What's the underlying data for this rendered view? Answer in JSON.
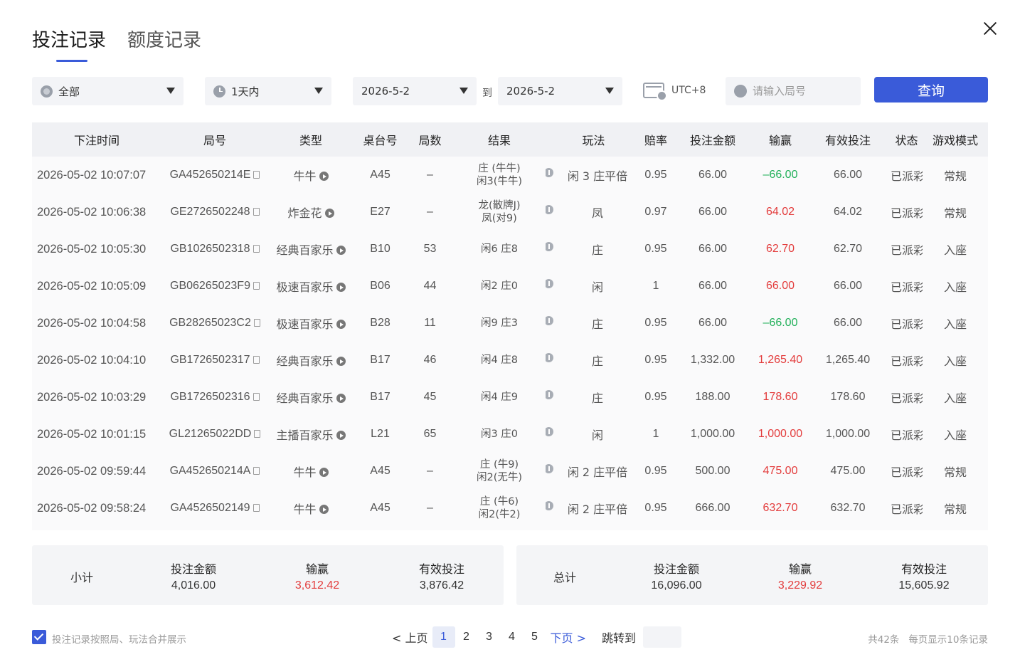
{
  "tabs": [
    {
      "label": "投注记录",
      "active": true
    },
    {
      "label": "额度记录",
      "active": false
    }
  ],
  "filters": {
    "game_select": "全部",
    "period_select": "1天内",
    "date_from": "2026-5-2",
    "to_label": "到",
    "date_to": "2026-5-2",
    "timezone": "UTC+8",
    "round_search_placeholder": "请输入局号",
    "query_button": "查询"
  },
  "table": {
    "headers": [
      "下注时间",
      "局号",
      "类型",
      "桌台号",
      "局数",
      "结果",
      "玩法",
      "赔率",
      "投注金额",
      "输赢",
      "有效投注",
      "状态",
      "游戏模式"
    ],
    "rows": [
      {
        "time": "2026-05-02 10:07:07",
        "round": "GA452650214E",
        "type": "牛牛",
        "table": "A45",
        "count": "–",
        "result1": "庄 (牛牛)",
        "result2": "闲3(牛牛)",
        "play": "闲 3 庄平倍",
        "odds": "0.95",
        "bet": "66.00",
        "win": "–66.00",
        "sign": "neg",
        "valid": "66.00",
        "status": "已派彩",
        "mode": "常规"
      },
      {
        "time": "2026-05-02 10:06:38",
        "round": "GE2726502248",
        "type": "炸金花",
        "table": "E27",
        "count": "–",
        "result1": "龙(散牌J)",
        "result2": "凤(对9)",
        "play": "凤",
        "odds": "0.97",
        "bet": "66.00",
        "win": "64.02",
        "sign": "pos",
        "valid": "64.02",
        "status": "已派彩",
        "mode": "常规"
      },
      {
        "time": "2026-05-02 10:05:30",
        "round": "GB1026502318",
        "type": "经典百家乐",
        "table": "B10",
        "count": "53",
        "result1": "闲6 庄8",
        "result2": "",
        "play": "庄",
        "odds": "0.95",
        "bet": "66.00",
        "win": "62.70",
        "sign": "pos",
        "valid": "62.70",
        "status": "已派彩",
        "mode": "入座"
      },
      {
        "time": "2026-05-02 10:05:09",
        "round": "GB06265023F9",
        "type": "极速百家乐",
        "table": "B06",
        "count": "44",
        "result1": "闲2 庄0",
        "result2": "",
        "play": "闲",
        "odds": "1",
        "bet": "66.00",
        "win": "66.00",
        "sign": "pos",
        "valid": "66.00",
        "status": "已派彩",
        "mode": "入座"
      },
      {
        "time": "2026-05-02 10:04:58",
        "round": "GB28265023C2",
        "type": "极速百家乐",
        "table": "B28",
        "count": "11",
        "result1": "闲9 庄3",
        "result2": "",
        "play": "庄",
        "odds": "0.95",
        "bet": "66.00",
        "win": "–66.00",
        "sign": "neg",
        "valid": "66.00",
        "status": "已派彩",
        "mode": "入座"
      },
      {
        "time": "2026-05-02 10:04:10",
        "round": "GB1726502317",
        "type": "经典百家乐",
        "table": "B17",
        "count": "46",
        "result1": "闲4 庄8",
        "result2": "",
        "play": "庄",
        "odds": "0.95",
        "bet": "1,332.00",
        "win": "1,265.40",
        "sign": "pos",
        "valid": "1,265.40",
        "status": "已派彩",
        "mode": "入座"
      },
      {
        "time": "2026-05-02 10:03:29",
        "round": "GB1726502316",
        "type": "经典百家乐",
        "table": "B17",
        "count": "45",
        "result1": "闲4 庄9",
        "result2": "",
        "play": "庄",
        "odds": "0.95",
        "bet": "188.00",
        "win": "178.60",
        "sign": "pos",
        "valid": "178.60",
        "status": "已派彩",
        "mode": "入座"
      },
      {
        "time": "2026-05-02 10:01:15",
        "round": "GL21265022DD",
        "type": "主播百家乐",
        "table": "L21",
        "count": "65",
        "result1": "闲3 庄0",
        "result2": "",
        "play": "闲",
        "odds": "1",
        "bet": "1,000.00",
        "win": "1,000.00",
        "sign": "pos",
        "valid": "1,000.00",
        "status": "已派彩",
        "mode": "入座"
      },
      {
        "time": "2026-05-02 09:59:44",
        "round": "GA452650214A",
        "type": "牛牛",
        "table": "A45",
        "count": "–",
        "result1": "庄 (牛9)",
        "result2": "闲2(无牛)",
        "play": "闲 2 庄平倍",
        "odds": "0.95",
        "bet": "500.00",
        "win": "475.00",
        "sign": "pos",
        "valid": "475.00",
        "status": "已派彩",
        "mode": "常规"
      },
      {
        "time": "2026-05-02 09:58:24",
        "round": "GA4526502149",
        "type": "牛牛",
        "table": "A45",
        "count": "–",
        "result1": "庄 (牛6)",
        "result2": "闲2(牛2)",
        "play": "闲 2 庄平倍",
        "odds": "0.95",
        "bet": "666.00",
        "win": "632.70",
        "sign": "pos",
        "valid": "632.70",
        "status": "已派彩",
        "mode": "常规"
      }
    ]
  },
  "subtotal": {
    "label": "小计",
    "bet_label": "投注金额",
    "bet": "4,016.00",
    "win_label": "输赢",
    "win": "3,612.42",
    "valid_label": "有效投注",
    "valid": "3,876.42"
  },
  "total": {
    "label": "总计",
    "bet_label": "投注金额",
    "bet": "16,096.00",
    "win_label": "输赢",
    "win": "3,229.92",
    "valid_label": "有效投注",
    "valid": "15,605.92"
  },
  "footer": {
    "merge_label": "投注记录按照局、玩法合并展示",
    "merge_checked": true,
    "prev": "< 上页",
    "pages": [
      "1",
      "2",
      "3",
      "4",
      "5"
    ],
    "current_page": "1",
    "next": "下页 >",
    "jump_label": "跳转到",
    "total_count": "共42条",
    "per_page": "每页显示10条记录"
  },
  "colors": {
    "accent": "#3a5bd9",
    "loss": "#22b05a",
    "win": "#e33c3c"
  }
}
